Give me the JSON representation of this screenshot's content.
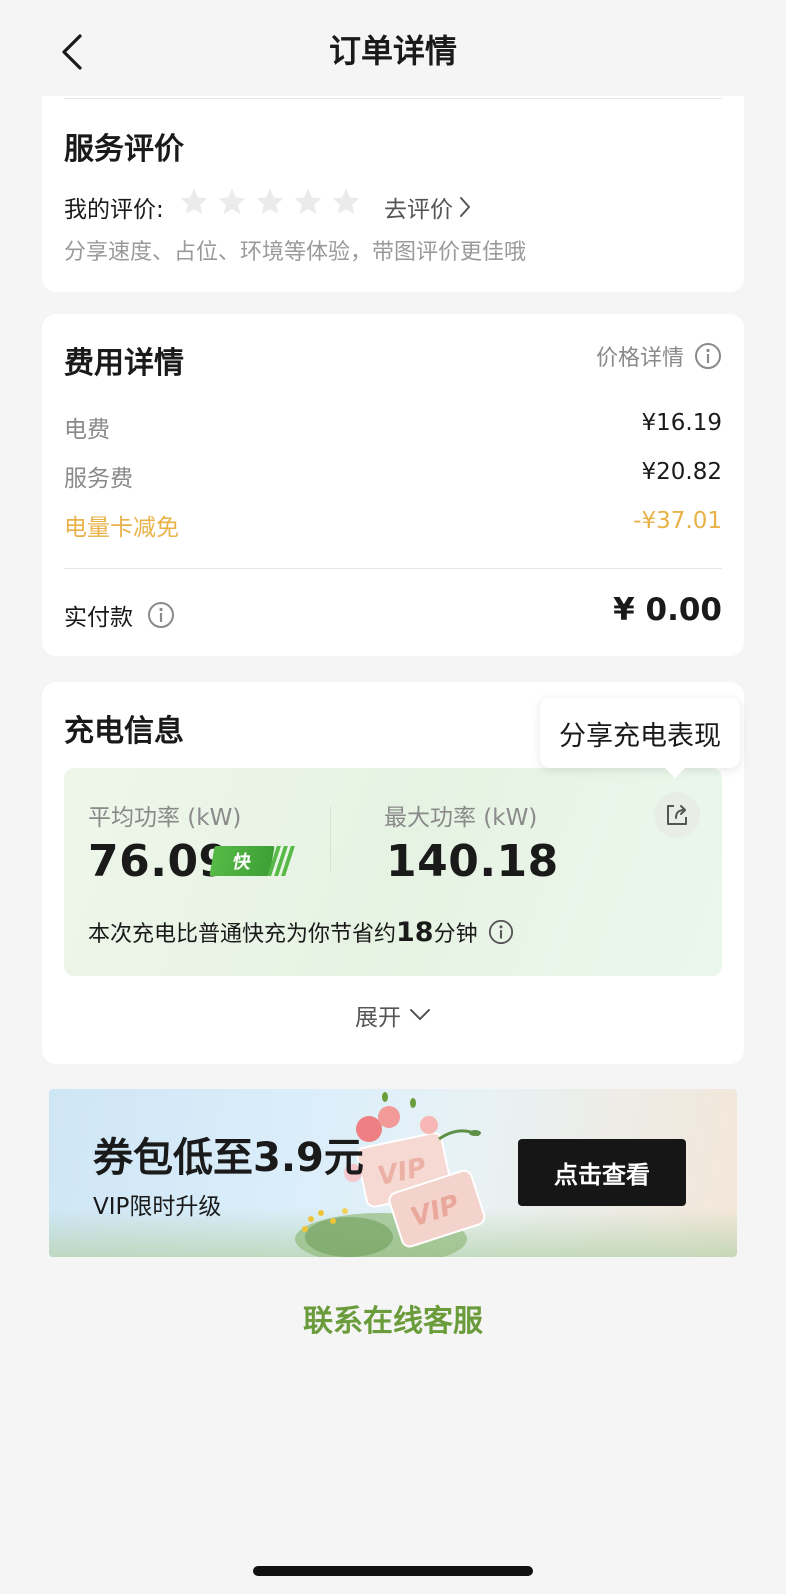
{
  "header": {
    "title": "订单详情"
  },
  "review": {
    "title": "服务评价",
    "my_review_label": "我的评价:",
    "rating": 0,
    "max_rating": 5,
    "go_review": "去评价",
    "hint": "分享速度、占位、环境等体验，带图评价更佳哦"
  },
  "fees": {
    "title": "费用详情",
    "price_detail": "价格详情",
    "rows": [
      {
        "name": "电费",
        "value": "¥16.19"
      },
      {
        "name": "服务费",
        "value": "¥20.82"
      },
      {
        "name": "电量卡减免",
        "value": "-¥37.01"
      }
    ],
    "paid_label": "实付款",
    "paid_value": "¥ 0.00",
    "discount_color": "#e8b249"
  },
  "charging": {
    "title": "充电信息",
    "share_tooltip": "分享充电表现",
    "avg_power_label": "平均功率 (kW)",
    "avg_power_value": "76.09",
    "fast_badge": "快",
    "max_power_label": "最大功率 (kW)",
    "max_power_value": "140.18",
    "save_prefix": "本次充电比普通快充为你节省约",
    "save_minutes": "18",
    "save_suffix": "分钟",
    "expand": "展开",
    "accent_color": "#57b947"
  },
  "banner": {
    "title": "券包低至3.9元",
    "subtitle": "VIP限时升级",
    "button": "点击查看",
    "card_text": "VIP"
  },
  "contact": {
    "label": "联系在线客服",
    "color": "#6a9c3b"
  }
}
